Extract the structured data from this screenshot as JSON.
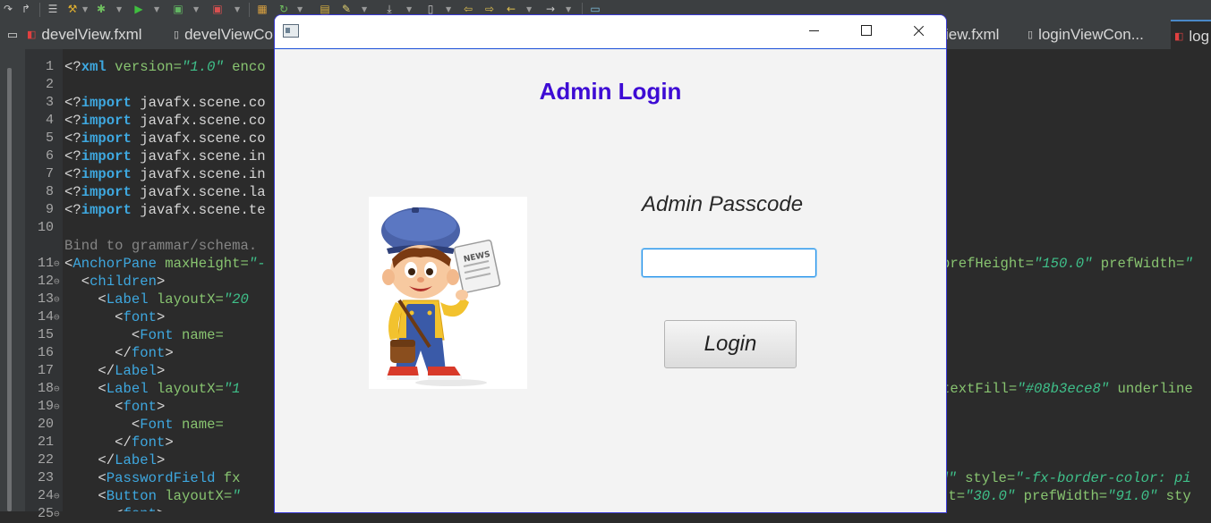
{
  "ide": {
    "tabs": [
      {
        "label": "develView.fxml"
      },
      {
        "label": "develViewCo"
      },
      {
        "label": "iew.fxml"
      },
      {
        "label": "loginViewCon..."
      },
      {
        "label": "log"
      }
    ],
    "line_numbers": [
      "1",
      "2",
      "3",
      "4",
      "5",
      "6",
      "7",
      "8",
      "9",
      "10",
      "",
      "11",
      "12",
      "13",
      "14",
      "15",
      "16",
      "17",
      "18",
      "19",
      "20",
      "21",
      "22",
      "23",
      "24",
      "25"
    ],
    "code_lines": [
      {
        "segments": [
          {
            "t": "<?",
            "c": "pi"
          },
          {
            "t": "xml",
            "c": "kw"
          },
          {
            "t": " version=",
            "c": "an"
          },
          {
            "t": "\"1.0\"",
            "c": "av"
          },
          {
            "t": " enco",
            "c": "an"
          }
        ]
      },
      {
        "segments": []
      },
      {
        "segments": [
          {
            "t": "<?",
            "c": "pi"
          },
          {
            "t": "import",
            "c": "kw"
          },
          {
            "t": " javafx.scene.co",
            "c": "tx"
          }
        ]
      },
      {
        "segments": [
          {
            "t": "<?",
            "c": "pi"
          },
          {
            "t": "import",
            "c": "kw"
          },
          {
            "t": " javafx.scene.co",
            "c": "tx"
          }
        ]
      },
      {
        "segments": [
          {
            "t": "<?",
            "c": "pi"
          },
          {
            "t": "import",
            "c": "kw"
          },
          {
            "t": " javafx.scene.co",
            "c": "tx"
          }
        ]
      },
      {
        "segments": [
          {
            "t": "<?",
            "c": "pi"
          },
          {
            "t": "import",
            "c": "kw"
          },
          {
            "t": " javafx.scene.in",
            "c": "tx"
          }
        ]
      },
      {
        "segments": [
          {
            "t": "<?",
            "c": "pi"
          },
          {
            "t": "import",
            "c": "kw"
          },
          {
            "t": " javafx.scene.in",
            "c": "tx"
          }
        ]
      },
      {
        "segments": [
          {
            "t": "<?",
            "c": "pi"
          },
          {
            "t": "import",
            "c": "kw"
          },
          {
            "t": " javafx.scene.la",
            "c": "tx"
          }
        ]
      },
      {
        "segments": [
          {
            "t": "<?",
            "c": "pi"
          },
          {
            "t": "import",
            "c": "kw"
          },
          {
            "t": " javafx.scene.te",
            "c": "tx"
          }
        ]
      },
      {
        "segments": []
      },
      {
        "segments": [
          {
            "t": "Bind to grammar/schema.",
            "c": "gy"
          }
        ]
      },
      {
        "segments": [
          {
            "t": "<",
            "c": "pi"
          },
          {
            "t": "AnchorPane",
            "c": "tg"
          },
          {
            "t": " maxHeight=",
            "c": "an"
          },
          {
            "t": "\"-",
            "c": "av"
          }
        ]
      },
      {
        "segments": [
          {
            "t": "  <",
            "c": "pi"
          },
          {
            "t": "children",
            "c": "tg"
          },
          {
            "t": ">",
            "c": "pi"
          }
        ]
      },
      {
        "segments": [
          {
            "t": "    <",
            "c": "pi"
          },
          {
            "t": "Label",
            "c": "tg"
          },
          {
            "t": " layoutX=",
            "c": "an"
          },
          {
            "t": "\"20",
            "c": "av"
          }
        ]
      },
      {
        "segments": [
          {
            "t": "      <",
            "c": "pi"
          },
          {
            "t": "font",
            "c": "tg"
          },
          {
            "t": ">",
            "c": "pi"
          }
        ]
      },
      {
        "segments": [
          {
            "t": "        <",
            "c": "pi"
          },
          {
            "t": "Font",
            "c": "tg"
          },
          {
            "t": " name=",
            "c": "an"
          }
        ]
      },
      {
        "segments": [
          {
            "t": "      </",
            "c": "pi"
          },
          {
            "t": "font",
            "c": "tg"
          },
          {
            "t": ">",
            "c": "pi"
          }
        ]
      },
      {
        "segments": [
          {
            "t": "    </",
            "c": "pi"
          },
          {
            "t": "Label",
            "c": "tg"
          },
          {
            "t": ">",
            "c": "pi"
          }
        ]
      },
      {
        "segments": [
          {
            "t": "    <",
            "c": "pi"
          },
          {
            "t": "Label",
            "c": "tg"
          },
          {
            "t": " layoutX=",
            "c": "an"
          },
          {
            "t": "\"1",
            "c": "av"
          }
        ]
      },
      {
        "segments": [
          {
            "t": "      <",
            "c": "pi"
          },
          {
            "t": "font",
            "c": "tg"
          },
          {
            "t": ">",
            "c": "pi"
          }
        ]
      },
      {
        "segments": [
          {
            "t": "        <",
            "c": "pi"
          },
          {
            "t": "Font",
            "c": "tg"
          },
          {
            "t": " name=",
            "c": "an"
          }
        ]
      },
      {
        "segments": [
          {
            "t": "      </",
            "c": "pi"
          },
          {
            "t": "font",
            "c": "tg"
          },
          {
            "t": ">",
            "c": "pi"
          }
        ]
      },
      {
        "segments": [
          {
            "t": "    </",
            "c": "pi"
          },
          {
            "t": "Label",
            "c": "tg"
          },
          {
            "t": ">",
            "c": "pi"
          }
        ]
      },
      {
        "segments": [
          {
            "t": "    <",
            "c": "pi"
          },
          {
            "t": "PasswordField",
            "c": "tg"
          },
          {
            "t": " fx",
            "c": "an"
          }
        ]
      },
      {
        "segments": [
          {
            "t": "    <",
            "c": "pi"
          },
          {
            "t": "Button",
            "c": "tg"
          },
          {
            "t": " layoutX=",
            "c": "an"
          },
          {
            "t": "\"",
            "c": "av"
          }
        ]
      },
      {
        "segments": [
          {
            "t": "      <",
            "c": "pi"
          },
          {
            "t": "font",
            "c": "tg"
          },
          {
            "t": ">",
            "c": "pi"
          }
        ]
      }
    ],
    "code_right_lines": [
      {
        "segments": [
          {
            "t": "prefHeight=",
            "c": "an"
          },
          {
            "t": "\"150.0\"",
            "c": "av"
          },
          {
            "t": " prefWidth=",
            "c": "an"
          },
          {
            "t": "\"",
            "c": "av"
          }
        ]
      },
      {
        "segments": [
          {
            "t": "textFill=",
            "c": "an"
          },
          {
            "t": "\"#08b3ece8\"",
            "c": "av"
          },
          {
            "t": " underline",
            "c": "an"
          }
        ]
      },
      {
        "segments": [
          {
            "t": "d\"",
            "c": "av"
          },
          {
            "t": " style=",
            "c": "an"
          },
          {
            "t": "\"-fx-border-color: pi",
            "c": "av"
          }
        ]
      },
      {
        "segments": [
          {
            "t": "nt=",
            "c": "an"
          },
          {
            "t": "\"30.0\"",
            "c": "av"
          },
          {
            "t": " prefWidth=",
            "c": "an"
          },
          {
            "t": "\"91.0\"",
            "c": "av"
          },
          {
            "t": " sty",
            "c": "an"
          }
        ]
      }
    ]
  },
  "app": {
    "title": "Admin Login",
    "passcode_label": "Admin Passcode",
    "passcode_value": "",
    "login_label": "Login",
    "title_color": "#3d0bd4"
  },
  "icons": {
    "window_icon": "java-window-icon",
    "minimize": "minimize-icon",
    "maximize": "maximize-icon",
    "close": "close-icon",
    "mascot": "newsboy-cartoon-image"
  }
}
